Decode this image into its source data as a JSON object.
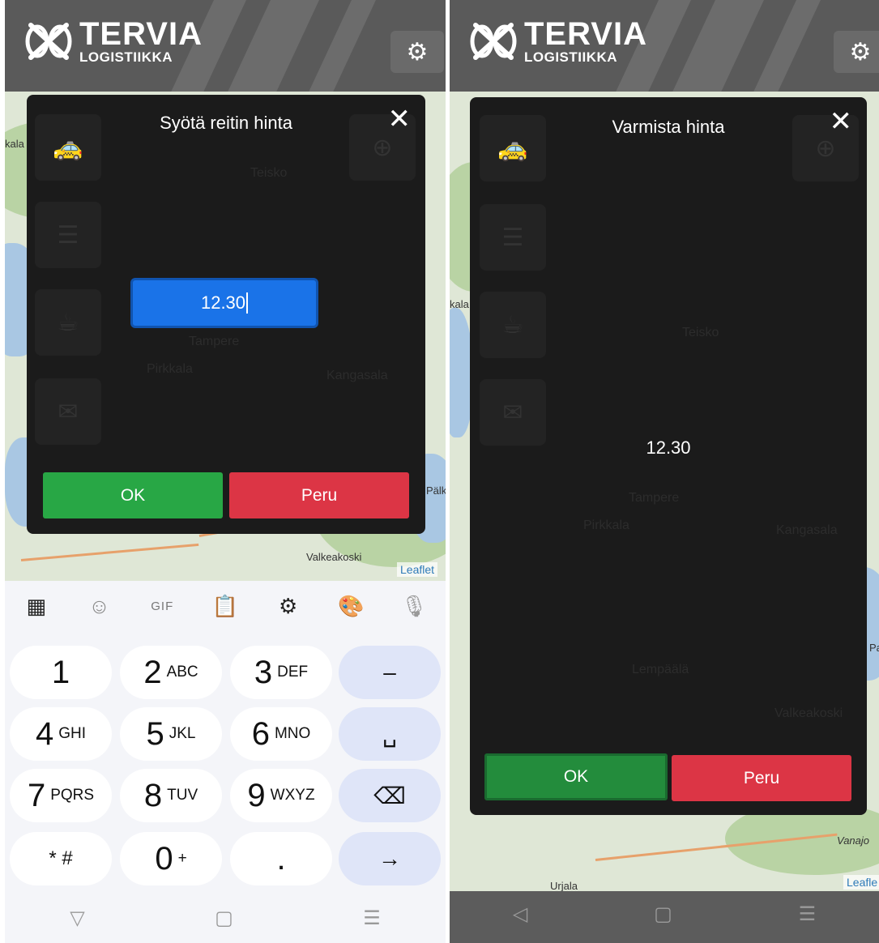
{
  "app": {
    "logo_main": "TERVIA",
    "logo_sub": "LOGISTIIKKA"
  },
  "icons": {
    "settings": "gear-icon",
    "close": "close-icon",
    "taxi": "taxi-icon",
    "list": "list-icon",
    "coffee": "coffee-icon",
    "mail": "mail-icon",
    "locate": "locate-icon"
  },
  "left": {
    "dialog_title": "Syötä reitin hinta",
    "price_value": "12.30",
    "ok_label": "OK",
    "cancel_label": "Peru",
    "map_places": {
      "p1": "Valkeakoski",
      "p2": "Pälk",
      "p3": "kala"
    },
    "map_ghost": {
      "g1": "Tampere",
      "g2": "Kangasala",
      "g3": "Teisko",
      "g4": "Pirkkala"
    },
    "attribution": "Leaflet",
    "keyboard": {
      "toolbar": [
        "apps-icon",
        "sticker-icon",
        "gif-icon",
        "clipboard-icon",
        "settings-icon",
        "palette-icon",
        "mic-icon"
      ],
      "gif_label": "GIF",
      "keys": [
        {
          "main": "1",
          "sub": ""
        },
        {
          "main": "2",
          "sub": "ABC"
        },
        {
          "main": "3",
          "sub": "DEF"
        },
        {
          "main": "–",
          "sub": ""
        },
        {
          "main": "4",
          "sub": "GHI"
        },
        {
          "main": "5",
          "sub": "JKL"
        },
        {
          "main": "6",
          "sub": "MNO"
        },
        {
          "main": "␣",
          "sub": ""
        },
        {
          "main": "7",
          "sub": "PQRS"
        },
        {
          "main": "8",
          "sub": "TUV"
        },
        {
          "main": "9",
          "sub": "WXYZ"
        },
        {
          "main": "⌫",
          "sub": ""
        },
        {
          "main": "* #",
          "sub": ""
        },
        {
          "main": "0",
          "sub": "+"
        },
        {
          "main": ".",
          "sub": ""
        },
        {
          "main": "→",
          "sub": ""
        }
      ]
    },
    "nav": {
      "back": "▽",
      "home": "▢",
      "menu": "☰"
    }
  },
  "right": {
    "dialog_title": "Varmista hinta",
    "price_value": "12.30",
    "ok_label": "OK",
    "cancel_label": "Peru",
    "map_places": {
      "p1": "Urjala",
      "p2": "Vanajo",
      "p3": "kala",
      "p4": "Pa"
    },
    "map_ghost": {
      "g1": "Tampere",
      "g2": "Teisko",
      "g3": "Kangasala",
      "g4": "Lempäälä",
      "g5": "Valkeakoski",
      "g6": "Pirkkala"
    },
    "attribution": "Leafle",
    "nav": {
      "back": "◁",
      "home": "▢",
      "menu": "☰"
    }
  }
}
